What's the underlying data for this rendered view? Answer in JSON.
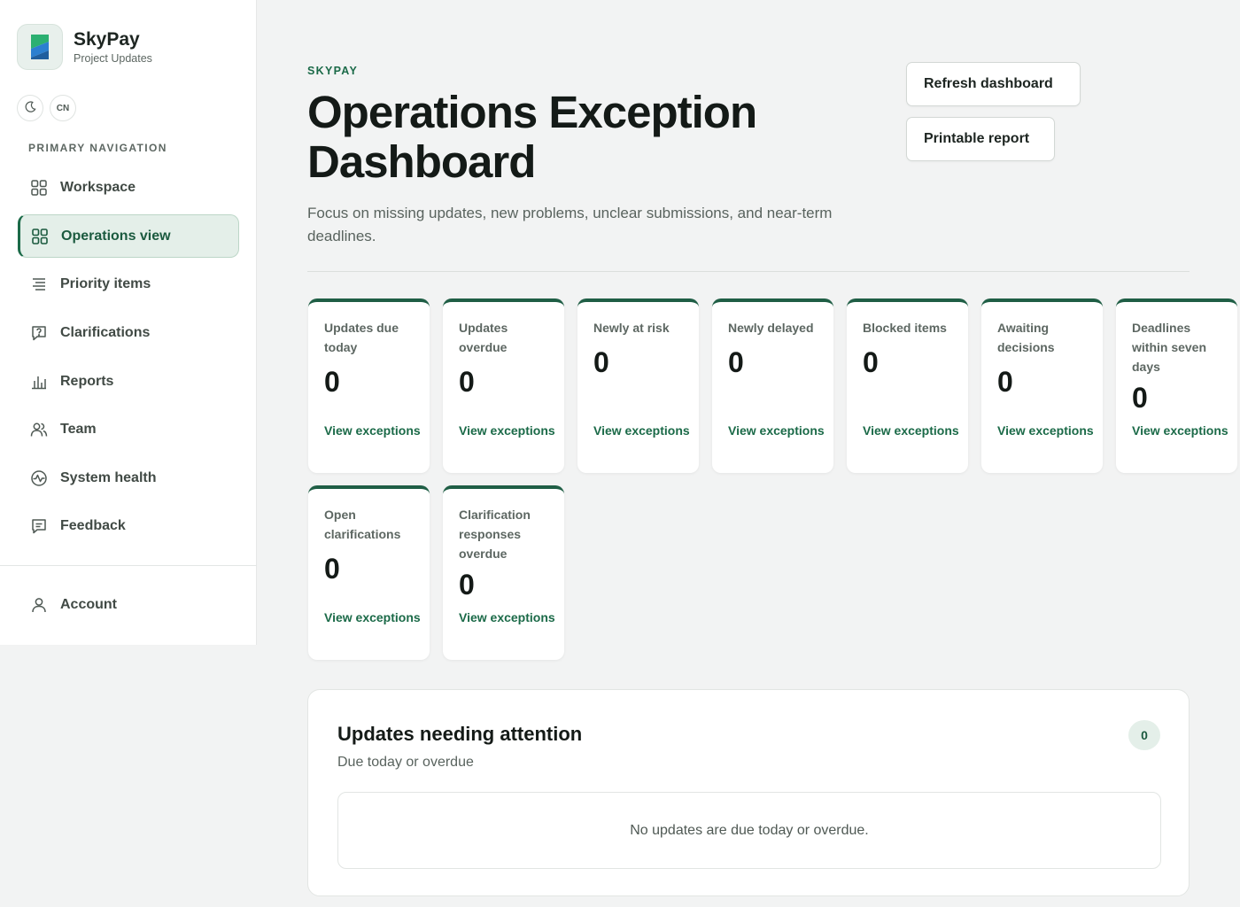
{
  "brand": {
    "name": "SkyPay",
    "subtitle": "Project Updates",
    "colors": {
      "primary": "#1b6a48",
      "logo_blue": "#2b7fd0",
      "logo_green": "#2bb071"
    }
  },
  "toggles": {
    "theme_icon": "moon-icon",
    "language": "CN"
  },
  "nav": {
    "heading": "PRIMARY NAVIGATION",
    "items": [
      {
        "label": "Workspace",
        "icon": "grid-icon",
        "active": false
      },
      {
        "label": "Operations view",
        "icon": "grid-icon",
        "active": true
      },
      {
        "label": "Priority items",
        "icon": "list-icon",
        "active": false
      },
      {
        "label": "Clarifications",
        "icon": "chat-question-icon",
        "active": false
      },
      {
        "label": "Reports",
        "icon": "bar-chart-icon",
        "active": false
      },
      {
        "label": "Team",
        "icon": "users-icon",
        "active": false
      },
      {
        "label": "System health",
        "icon": "pulse-icon",
        "active": false
      },
      {
        "label": "Feedback",
        "icon": "message-icon",
        "active": false
      }
    ],
    "account": {
      "label": "Account",
      "icon": "user-icon"
    }
  },
  "header": {
    "eyebrow": "SKYPAY",
    "title": "Operations Exception Dashboard",
    "description": "Focus on missing updates, new problems, unclear submissions, and near-term deadlines."
  },
  "actions": {
    "refresh": "Refresh dashboard",
    "print": "Printable report"
  },
  "cards": [
    {
      "label": "Updates due today",
      "value": "0",
      "link": "View exceptions"
    },
    {
      "label": "Updates overdue",
      "value": "0",
      "link": "View exceptions"
    },
    {
      "label": "Newly at risk",
      "value": "0",
      "link": "View exceptions"
    },
    {
      "label": "Newly delayed",
      "value": "0",
      "link": "View exceptions"
    },
    {
      "label": "Blocked items",
      "value": "0",
      "link": "View exceptions"
    },
    {
      "label": "Awaiting decisions",
      "value": "0",
      "link": "View exceptions"
    },
    {
      "label": "Deadlines within seven days",
      "value": "0",
      "link": "View exceptions"
    },
    {
      "label": "Open clarifications",
      "value": "0",
      "link": "View exceptions"
    },
    {
      "label": "Clarification responses overdue",
      "value": "0",
      "link": "View exceptions"
    }
  ],
  "attention": {
    "title": "Updates needing attention",
    "subtitle": "Due today or overdue",
    "count": "0",
    "empty_message": "No updates are due today or overdue."
  }
}
